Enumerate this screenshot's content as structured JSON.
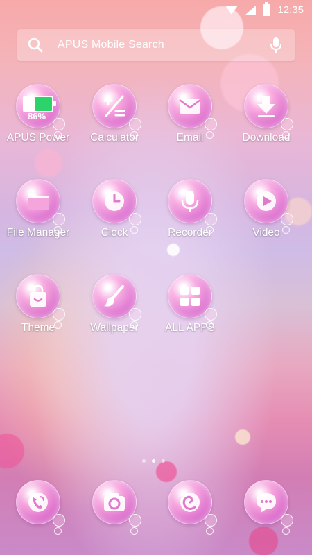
{
  "status_bar": {
    "time": "12:35",
    "wifi_icon": "wifi-icon",
    "signal_icon": "signal-icon",
    "battery_icon": "battery-icon"
  },
  "search": {
    "placeholder": "APUS Mobile Search",
    "icon": "search-icon",
    "voice_icon": "microphone-icon"
  },
  "apps": [
    {
      "label": "APUS Power",
      "icon": "battery-icon",
      "battery_percent": "86%"
    },
    {
      "label": "Calculator",
      "icon": "calculator-icon"
    },
    {
      "label": "Email",
      "icon": "envelope-icon"
    },
    {
      "label": "Download",
      "icon": "download-icon"
    },
    {
      "label": "File Manager",
      "icon": "folder-icon"
    },
    {
      "label": "Clock",
      "icon": "clock-icon"
    },
    {
      "label": "Recorder",
      "icon": "microphone-icon"
    },
    {
      "label": "Video",
      "icon": "play-icon"
    },
    {
      "label": "Theme",
      "icon": "shopping-bag-icon"
    },
    {
      "label": "Wallpaper",
      "icon": "paintbrush-icon"
    },
    {
      "label": "ALL APPS",
      "icon": "grid-icon"
    }
  ],
  "page_indicator": {
    "pages": 3,
    "current": 2
  },
  "dock": [
    {
      "name": "phone",
      "icon": "phone-icon"
    },
    {
      "name": "camera",
      "icon": "camera-icon"
    },
    {
      "name": "browser",
      "icon": "swirl-icon"
    },
    {
      "name": "messages",
      "icon": "chat-bubble-icon"
    }
  ]
}
